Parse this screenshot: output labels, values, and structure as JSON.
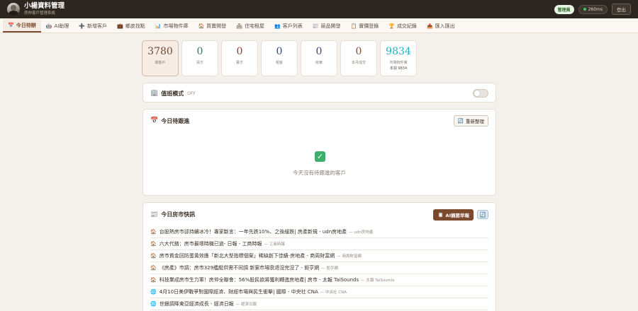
{
  "header": {
    "title": "小楊資料管理",
    "subtitle": "房仲客戶管理系統",
    "role_badge": "管理員",
    "latency": "260ms",
    "logout_label": "登出"
  },
  "tabs": [
    {
      "icon": "calendar-icon",
      "glyph": "📅",
      "label": "今日待辦",
      "active": true
    },
    {
      "icon": "robot-icon",
      "glyph": "🤖",
      "label": "AI助理"
    },
    {
      "icon": "plus-icon",
      "glyph": "➕",
      "label": "新增客戶"
    },
    {
      "icon": "briefcase-icon",
      "glyph": "💼",
      "label": "鄉皮找點"
    },
    {
      "icon": "chart-icon",
      "glyph": "📊",
      "label": "市場物件庫"
    },
    {
      "icon": "house-icon",
      "glyph": "🏠",
      "label": "買賣開發"
    },
    {
      "icon": "building-icon",
      "glyph": "🏘",
      "label": "住宅租屋"
    },
    {
      "icon": "people-icon",
      "glyph": "👥",
      "label": "客戶列表"
    },
    {
      "icon": "newspaper-icon",
      "glyph": "📰",
      "label": "競品開發"
    },
    {
      "icon": "clipboard-icon",
      "glyph": "📋",
      "label": "實價登錄"
    },
    {
      "icon": "trophy-icon",
      "glyph": "🏆",
      "label": "成交紀錄"
    },
    {
      "icon": "export-icon",
      "glyph": "📤",
      "label": "匯入匯出"
    }
  ],
  "stats": [
    {
      "value": "3780",
      "label": "總客戶",
      "color": "#6b4a34",
      "highlight": true
    },
    {
      "value": "0",
      "label": "買方",
      "color": "#2f7a5a"
    },
    {
      "value": "0",
      "label": "賣方",
      "color": "#8a3a2e"
    },
    {
      "value": "0",
      "label": "租客",
      "color": "#2a4b7a"
    },
    {
      "value": "0",
      "label": "房東",
      "color": "#4a3a7a"
    },
    {
      "value": "0",
      "label": "本月成交",
      "color": "#8a4a2e"
    },
    {
      "value": "9834",
      "label": "市場物件庫",
      "sub": "本週 9834",
      "color": "#1fb0c8"
    }
  ],
  "duty": {
    "title": "值班模式",
    "state": "OFF",
    "icon": "building-icon"
  },
  "todo": {
    "title": "今日待跟進",
    "reorganize_label": "重新整理",
    "empty_text": "今天沒有待跟進的客戶"
  },
  "news": {
    "title": "今日房市快訊",
    "ai_button_label": "AI摘要早報",
    "items": [
      {
        "icon": "house-icon",
        "glyph": "🏠",
        "title": "台股熱房市卻持續冰冷！專家斷言：一年先跌10%、之後緩跌| 房產新規 - udn房地產",
        "source": "— udn房地產"
      },
      {
        "icon": "house-icon",
        "glyph": "🏠",
        "title": "六大代銷：房市最壞時機已過- 日報 - 工商時報",
        "source": "— 工商時報"
      },
      {
        "icon": "house-icon",
        "glyph": "🏠",
        "title": "房市資金回防蛋黃效應「新北大型指標個案」稀缺創下佳績-房地產 - 商周財富網",
        "source": "— 商周財富網"
      },
      {
        "icon": "house-icon",
        "glyph": "🏠",
        "title": "《房產》市調：房市329艦艇供需不同調 新案市場衰退沒完沒了 - 鉅亨網",
        "source": "— 鉅亨網"
      },
      {
        "icon": "house-icon",
        "glyph": "🏠",
        "title": "科技業成房市生力軍！房仲全聯會：56%股民欲將獲利轉進房地產| 房市 - 太報 TaiSounds",
        "source": "— 太報 TaiSounds"
      },
      {
        "icon": "globe-icon",
        "glyph": "🌐",
        "title": "4月10日美伊戰爭對國際經濟、財經市場與民生衝擊| 國際 - 中央社 CNA",
        "source": "— 中央社 CNA"
      },
      {
        "icon": "globe-icon",
        "glyph": "🌐",
        "title": "世銀調降東亞經濟成長 - 經濟日報",
        "source": "— 經濟日報"
      }
    ]
  }
}
